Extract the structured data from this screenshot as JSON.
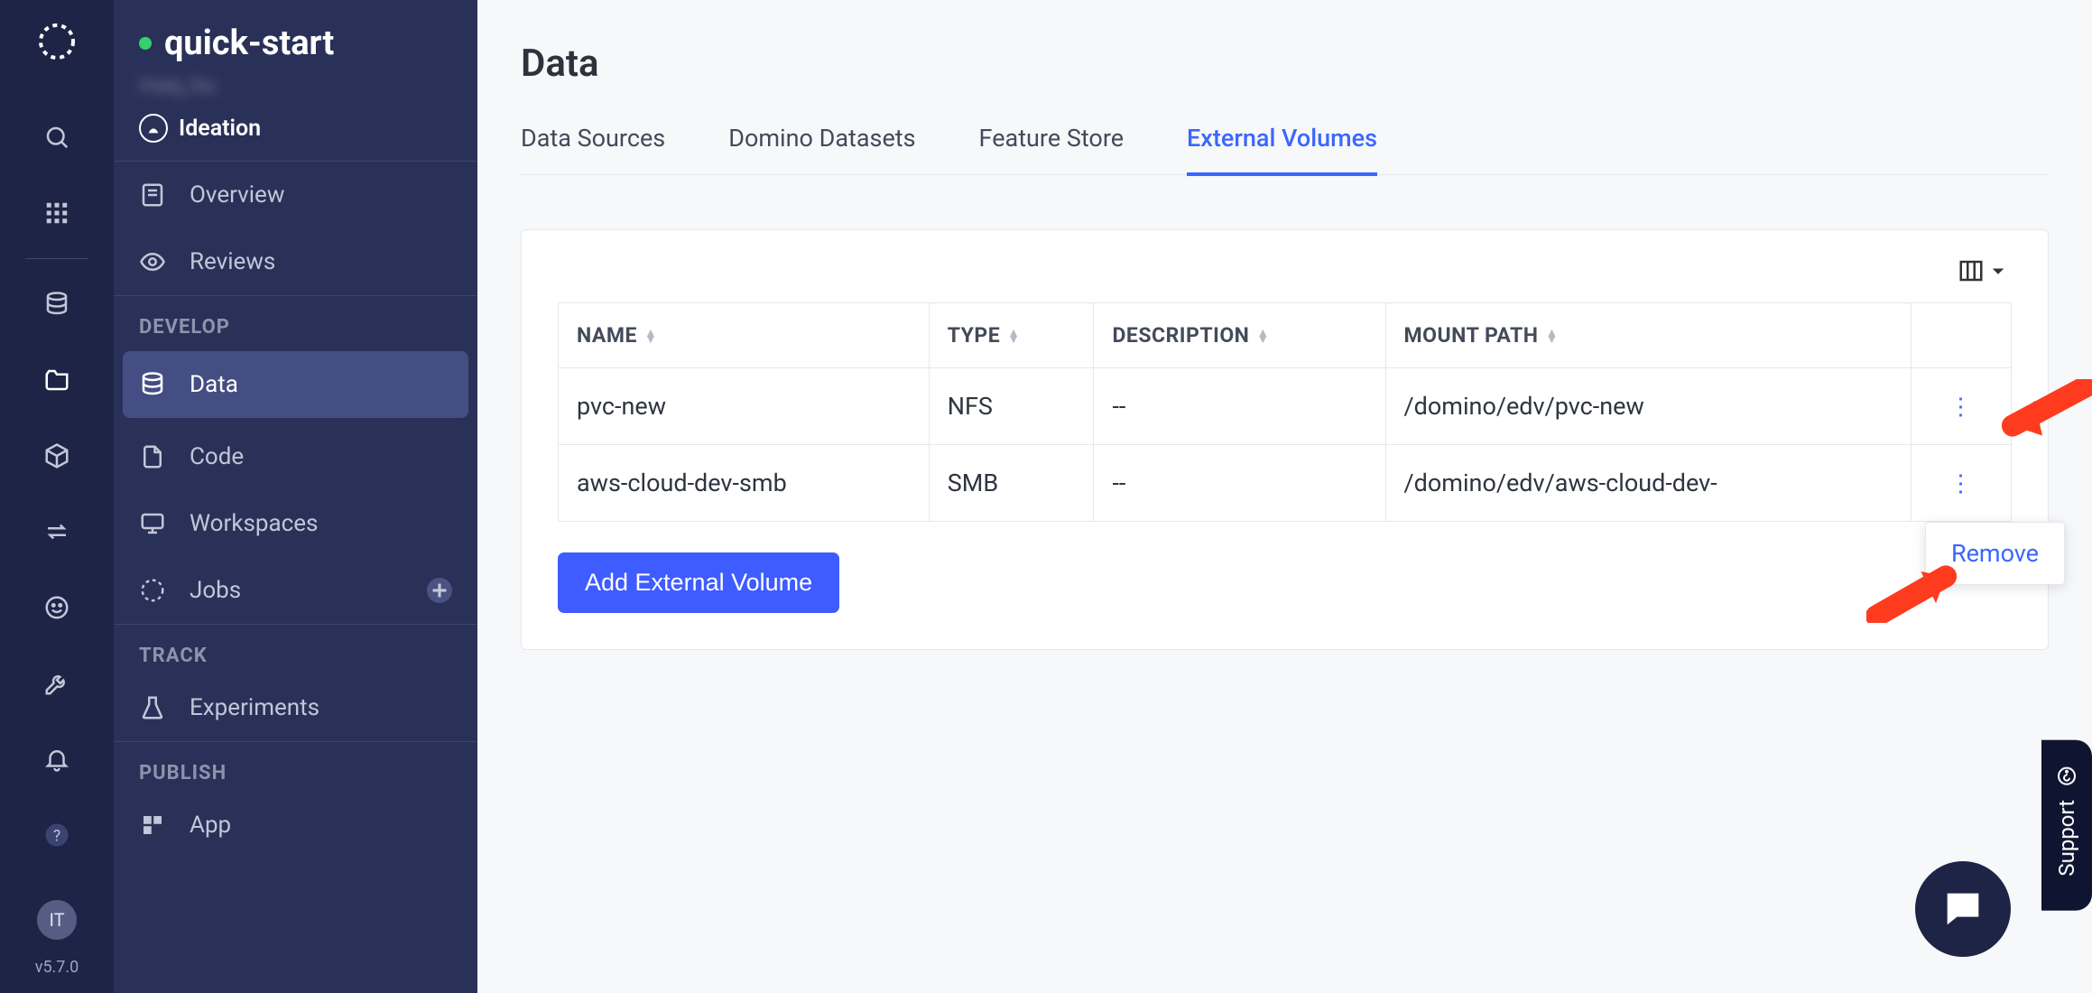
{
  "rail": {
    "avatar": "IT",
    "version": "v5.7.0"
  },
  "project": {
    "name": "quick-start",
    "owner": "maq_hu",
    "stage": "Ideation"
  },
  "sidebar": {
    "items": [
      {
        "label": "Overview"
      },
      {
        "label": "Reviews"
      }
    ],
    "develop_label": "DEVELOP",
    "develop": [
      {
        "label": "Data"
      },
      {
        "label": "Code"
      },
      {
        "label": "Workspaces"
      },
      {
        "label": "Jobs"
      }
    ],
    "track_label": "TRACK",
    "track": [
      {
        "label": "Experiments"
      }
    ],
    "publish_label": "PUBLISH",
    "publish": [
      {
        "label": "App"
      }
    ]
  },
  "page": {
    "title": "Data",
    "tabs": [
      {
        "label": "Data Sources"
      },
      {
        "label": "Domino Datasets"
      },
      {
        "label": "Feature Store"
      },
      {
        "label": "External Volumes"
      }
    ],
    "active_tab": 3
  },
  "table": {
    "columns": [
      {
        "label": "NAME"
      },
      {
        "label": "TYPE"
      },
      {
        "label": "DESCRIPTION"
      },
      {
        "label": "MOUNT PATH"
      }
    ],
    "rows": [
      {
        "name": "pvc-new",
        "type": "NFS",
        "description": "--",
        "mount": "/domino/edv/pvc-new"
      },
      {
        "name": "aws-cloud-dev-smb",
        "type": "SMB",
        "description": "--",
        "mount": "/domino/edv/aws-cloud-dev-"
      }
    ]
  },
  "buttons": {
    "add_volume": "Add External Volume"
  },
  "popover": {
    "remove": "Remove"
  },
  "support": {
    "label": "Support"
  }
}
